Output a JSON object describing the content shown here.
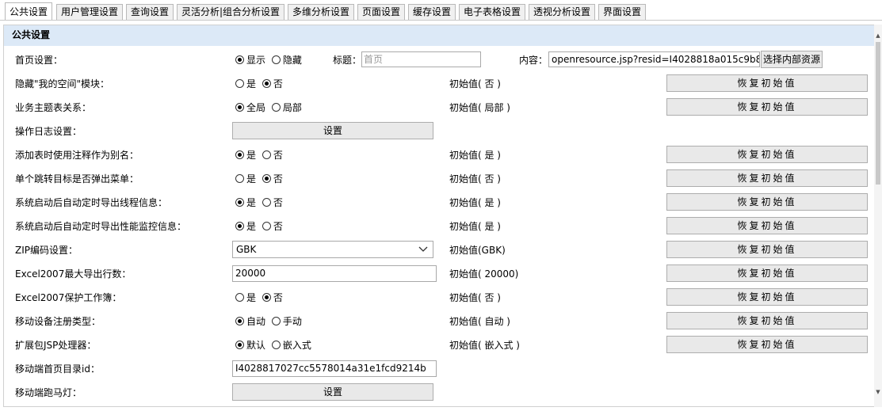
{
  "tabs": [
    {
      "label": "公共设置"
    },
    {
      "label": "用户管理设置"
    },
    {
      "label": "查询设置"
    },
    {
      "label": "灵活分析|组合分析设置"
    },
    {
      "label": "多维分析设置"
    },
    {
      "label": "页面设置"
    },
    {
      "label": "缓存设置"
    },
    {
      "label": "电子表格设置"
    },
    {
      "label": "透视分析设置"
    },
    {
      "label": "界面设置"
    }
  ],
  "section_title": "公共设置",
  "reset_label": "恢复初始值",
  "set_label": "设置",
  "home": {
    "label": "首页设置：",
    "show": "显示",
    "hide": "隐藏",
    "title_label": "标题：",
    "title_placeholder": "首页",
    "content_label": "内容：",
    "content_value": "openresource.jsp?resid=I4028818a015c9b8",
    "choose_button": "选择内部资源"
  },
  "rows": {
    "myspace": {
      "label": "隐藏\"我的空间\"模块：",
      "opt1": "是",
      "opt2": "否",
      "initial": "初始值( 否 )"
    },
    "topic": {
      "label": "业务主题表关系：",
      "opt1": "全局",
      "opt2": "局部",
      "initial": "初始值( 局部 )"
    },
    "oplog": {
      "label": "操作日志设置："
    },
    "alias": {
      "label": "添加表时使用注释作为别名：",
      "opt1": "是",
      "opt2": "否",
      "initial": "初始值( 是 )"
    },
    "jump": {
      "label": "单个跳转目标是否弹出菜单：",
      "opt1": "是",
      "opt2": "否",
      "initial": "初始值( 否 )"
    },
    "thread": {
      "label": "系统启动后自动定时导出线程信息：",
      "opt1": "是",
      "opt2": "否",
      "initial": "初始值( 是 )"
    },
    "perf": {
      "label": "系统启动后自动定时导出性能监控信息：",
      "opt1": "是",
      "opt2": "否",
      "initial": "初始值( 是 )"
    },
    "zip": {
      "label": "ZIP编码设置：",
      "value": "GBK",
      "initial": "初始值(GBK)"
    },
    "excelrows": {
      "label": "Excel2007最大导出行数：",
      "value": "20000",
      "initial": "初始值( 20000)"
    },
    "excelprotect": {
      "label": "Excel2007保护工作簿：",
      "opt1": "是",
      "opt2": "否",
      "initial": "初始值( 否 )"
    },
    "mobiletype": {
      "label": "移动设备注册类型：",
      "opt1": "自动",
      "opt2": "手动",
      "initial": "初始值( 自动 )"
    },
    "jsp": {
      "label": "扩展包JSP处理器：",
      "opt1": "默认",
      "opt2": "嵌入式",
      "initial": "初始值( 嵌入式 )"
    },
    "mobiledir": {
      "label": "移动端首页目录id：",
      "value": "I4028817027cc5578014a31e1fcd9214b"
    },
    "marquee": {
      "label": "移动端跑马灯："
    }
  }
}
